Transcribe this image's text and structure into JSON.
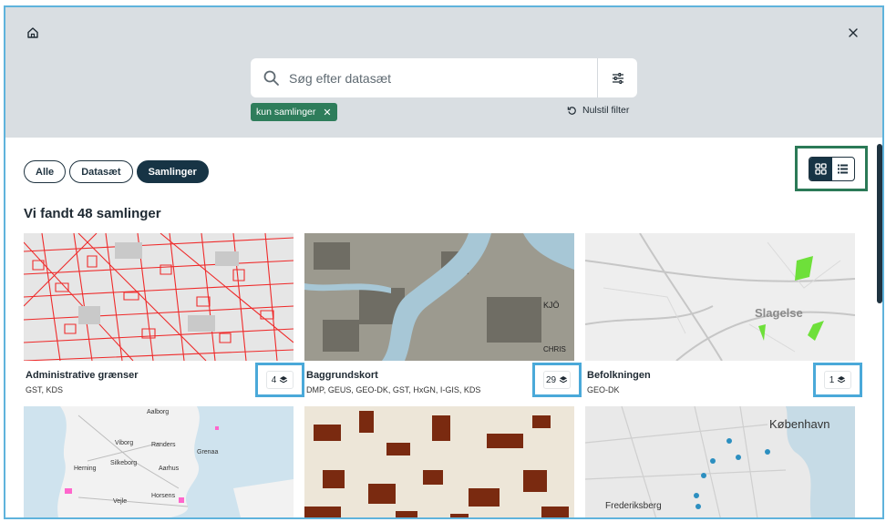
{
  "header": {
    "home_icon": "home-icon",
    "close_icon": "close-icon"
  },
  "search": {
    "placeholder": "Søg efter datasæt",
    "value": ""
  },
  "filters": {
    "chip_label": "kun samlinger",
    "chip_remove": "✕",
    "reset_label": "Nulstil filter"
  },
  "tabs": [
    {
      "label": "Alle",
      "active": false
    },
    {
      "label": "Datasæt",
      "active": false
    },
    {
      "label": "Samlinger",
      "active": true
    }
  ],
  "view_toggle": {
    "grid_active": true
  },
  "results": {
    "heading": "Vi fandt 48 samlinger"
  },
  "cards": [
    {
      "title": "Administrative grænser",
      "sources": "GST, KDS",
      "count": "4"
    },
    {
      "title": "Baggrundskort",
      "sources": "DMP, GEUS, GEO-DK, GST, HxGN, I-GIS, KDS",
      "count": "29"
    },
    {
      "title": "Befolkningen",
      "sources": "GEO-DK",
      "count": "1"
    }
  ],
  "map_labels": {
    "slagelse": "Slagelse",
    "kobenhavn": "København",
    "aalborg": "Aalborg",
    "randers": "Randers",
    "aarhus": "Aarhus",
    "vejle": "Vejle",
    "horsens": "Horsens",
    "herning": "Herning",
    "silkeborg": "Silkeborg",
    "viborg": "Viborg",
    "grenaa": "Grenaa",
    "frederiksberg": "Frederiksberg"
  },
  "colors": {
    "accent_green": "#2e7d5b",
    "dark_navy": "#173445",
    "highlight_blue": "#4aa9d9"
  }
}
